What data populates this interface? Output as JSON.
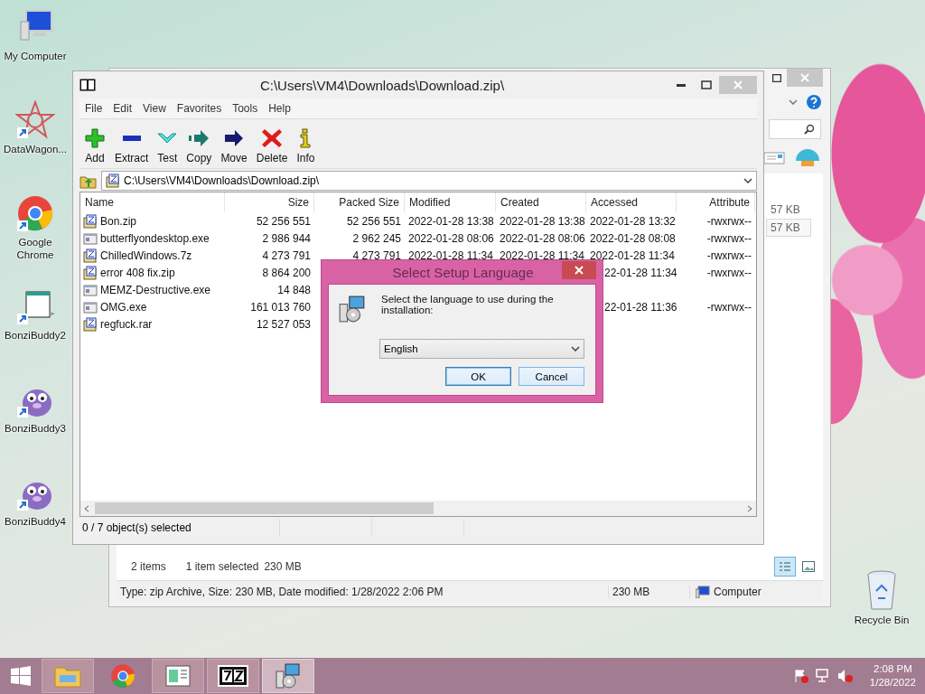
{
  "desktop_icons": [
    {
      "label": "My Computer",
      "kind": "computer",
      "shortcut": false
    },
    {
      "label": "DataWagon...",
      "kind": "star",
      "shortcut": true
    },
    {
      "label": "Google Chrome",
      "kind": "chrome",
      "shortcut": true
    },
    {
      "label": "BonziBuddy2",
      "kind": "flag",
      "shortcut": true
    },
    {
      "label": "BonziBuddy3",
      "kind": "creature",
      "shortcut": true
    },
    {
      "label": "BonziBuddy4",
      "kind": "creature",
      "shortcut": true
    }
  ],
  "recycle_bin": {
    "label": "Recycle Bin"
  },
  "explorer_window": {
    "file_sizes": [
      {
        "text": "57 KB",
        "selected": false
      },
      {
        "text": "57 KB",
        "selected": true
      }
    ],
    "view_buttons": [
      {
        "kind": "details",
        "selected": true
      },
      {
        "kind": "preview",
        "selected": false
      }
    ],
    "status": {
      "item_count": "2 items",
      "selection": "1 item selected",
      "selection_size": "230 MB"
    },
    "details_bar": {
      "description": "Type: zip Archive, Size: 230 MB, Date modified: 1/28/2022 2:06 PM",
      "size": "230 MB",
      "location": "Computer"
    }
  },
  "archive_window": {
    "title": "C:\\Users\\VM4\\Downloads\\Download.zip\\",
    "menu": [
      "File",
      "Edit",
      "View",
      "Favorites",
      "Tools",
      "Help"
    ],
    "toolbar": [
      {
        "label": "Add",
        "kind": "add"
      },
      {
        "label": "Extract",
        "kind": "extract"
      },
      {
        "label": "Test",
        "kind": "test"
      },
      {
        "label": "Copy",
        "kind": "copy"
      },
      {
        "label": "Move",
        "kind": "move"
      },
      {
        "label": "Delete",
        "kind": "delete"
      },
      {
        "label": "Info",
        "kind": "info"
      }
    ],
    "path": "C:\\Users\\VM4\\Downloads\\Download.zip\\",
    "columns": [
      "Name",
      "Size",
      "Packed Size",
      "Modified",
      "Created",
      "Accessed",
      "Attribute"
    ],
    "rows": [
      {
        "kind": "archive",
        "name": "Bon.zip",
        "size": "52 256 551",
        "packed_size": "52 256 551",
        "modified": "2022-01-28 13:38",
        "created": "2022-01-28 13:38",
        "accessed": "2022-01-28 13:32",
        "attributes": "-rwxrwx--"
      },
      {
        "kind": "program",
        "name": "butterflyondesktop.exe",
        "size": "2 986 944",
        "packed_size": "2 962 245",
        "modified": "2022-01-28 08:06",
        "created": "2022-01-28 08:06",
        "accessed": "2022-01-28 08:08",
        "attributes": "-rwxrwx--"
      },
      {
        "kind": "archive",
        "name": "ChilledWindows.7z",
        "size": "4 273 791",
        "packed_size": "4 273 791",
        "modified": "2022-01-28 11:34",
        "created": "2022-01-28 11:34",
        "accessed": "2022-01-28 11:34",
        "attributes": "-rwxrwx--"
      },
      {
        "kind": "archive",
        "name": "error 408 fix.zip",
        "size": "8 864 200",
        "accessed": "22-01-28 11:34",
        "attributes": "-rwxrwx--"
      },
      {
        "kind": "program",
        "name": "MEMZ-Destructive.exe",
        "size": "14 848"
      },
      {
        "kind": "program",
        "name": "OMG.exe",
        "size": "161 013 760",
        "accessed": "22-01-28 11:36",
        "attributes": "-rwxrwx--"
      },
      {
        "kind": "archive",
        "name": "regfuck.rar",
        "size": "12 527 053"
      }
    ],
    "status": "0 / 7 object(s) selected"
  },
  "dialog": {
    "title": "Select Setup Language",
    "message": "Select the language to use during the installation:",
    "language": "English",
    "buttons": [
      {
        "label": "OK",
        "default": true
      },
      {
        "label": "Cancel",
        "default": false
      }
    ]
  },
  "taskbar": {
    "apps": [
      {
        "kind": "folder",
        "running": true,
        "selected": false
      },
      {
        "kind": "chrome",
        "running": false,
        "selected": false
      },
      {
        "kind": "window",
        "running": true,
        "selected": false
      },
      {
        "kind": "sevenzip",
        "running": true,
        "selected": false
      },
      {
        "kind": "setup",
        "running": true,
        "selected": true
      }
    ],
    "time": "2:08 PM",
    "date": "1/28/2022"
  }
}
